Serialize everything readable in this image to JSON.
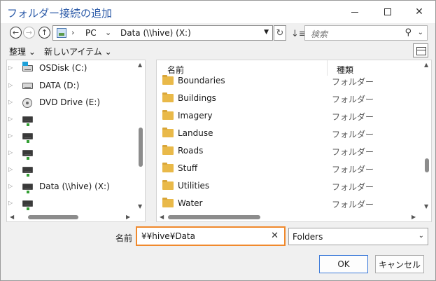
{
  "window": {
    "title": "フォルダー接続の追加"
  },
  "nav": {
    "address": {
      "segments": [
        "PC",
        "Data (\\\\hive)  (X:)"
      ]
    },
    "search": {
      "placeholder": "検索"
    }
  },
  "toolbar": {
    "organize_label": "整理 ⌄",
    "new_item_label": "新しいアイテム ⌄"
  },
  "tree": {
    "items": [
      {
        "label": "OSDisk (C:)",
        "icon": "os-drive-icon"
      },
      {
        "label": "DATA (D:)",
        "icon": "drive-icon"
      },
      {
        "label": "DVD Drive (E:)",
        "icon": "dvd-drive-icon"
      },
      {
        "label": "",
        "icon": "network-drive-icon"
      },
      {
        "label": "",
        "icon": "network-drive-icon"
      },
      {
        "label": "",
        "icon": "network-drive-icon"
      },
      {
        "label": "",
        "icon": "network-drive-icon"
      },
      {
        "label": "Data (\\\\hive)  (X:)",
        "icon": "network-drive-icon"
      },
      {
        "label": "",
        "icon": "network-drive-icon"
      }
    ]
  },
  "files": {
    "columns": {
      "name": "名前",
      "type": "種類"
    },
    "rows": [
      {
        "name": "Boundaries",
        "type": "フォルダー"
      },
      {
        "name": "Buildings",
        "type": "フォルダー"
      },
      {
        "name": "Imagery",
        "type": "フォルダー"
      },
      {
        "name": "Landuse",
        "type": "フォルダー"
      },
      {
        "name": "Roads",
        "type": "フォルダー"
      },
      {
        "name": "Stuff",
        "type": "フォルダー"
      },
      {
        "name": "Utilities",
        "type": "フォルダー"
      },
      {
        "name": "Water",
        "type": "フォルダー"
      }
    ]
  },
  "footer": {
    "name_label": "名前",
    "name_value": "¥¥hive¥Data",
    "type_value": "Folders",
    "ok_label": "OK",
    "cancel_label": "キャンセル"
  },
  "colors": {
    "accent": "#f0892c",
    "title": "#2b5aa8",
    "folder": "#e9b949"
  }
}
